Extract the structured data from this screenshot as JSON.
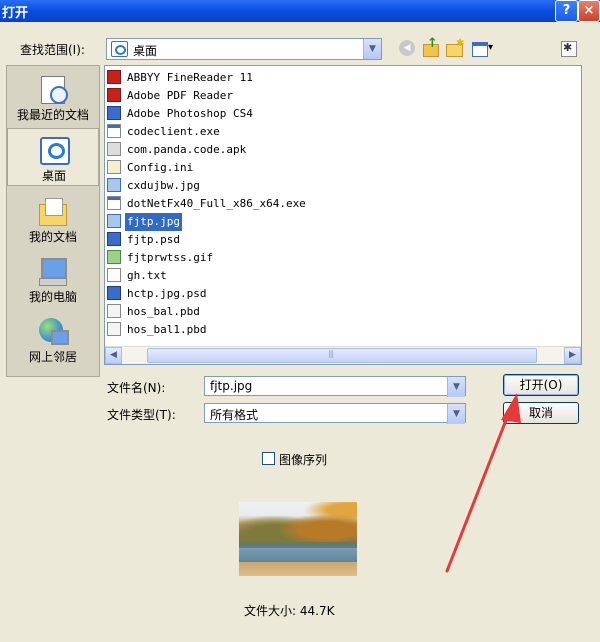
{
  "window": {
    "title": "打开",
    "help_glyph": "?",
    "close_glyph": "×"
  },
  "look_in": {
    "label": "查找范围(I):",
    "value": "桌面"
  },
  "places": [
    {
      "label": "我最近的文档",
      "icon": "recent-documents-icon"
    },
    {
      "label": "桌面",
      "icon": "desktop-icon",
      "selected": true
    },
    {
      "label": "我的文档",
      "icon": "my-documents-icon"
    },
    {
      "label": "我的电脑",
      "icon": "my-computer-icon"
    },
    {
      "label": "网上邻居",
      "icon": "network-places-icon"
    }
  ],
  "files": [
    {
      "name": "ABBYY FineReader 11",
      "icon": "abbyy-icon"
    },
    {
      "name": "Adobe PDF Reader",
      "icon": "pdf-icon"
    },
    {
      "name": "Adobe Photoshop CS4",
      "icon": "photoshop-icon"
    },
    {
      "name": "codeclient.exe",
      "icon": "exe-icon"
    },
    {
      "name": "com.panda.code.apk",
      "icon": "apk-icon"
    },
    {
      "name": "Config.ini",
      "icon": "ini-icon"
    },
    {
      "name": "cxdujbw.jpg",
      "icon": "jpg-icon"
    },
    {
      "name": "dotNetFx40_Full_x86_x64.exe",
      "icon": "exe-icon"
    },
    {
      "name": "fjtp.jpg",
      "icon": "jpg-icon",
      "selected": true
    },
    {
      "name": "fjtp.psd",
      "icon": "psd-icon"
    },
    {
      "name": "fjtprwtss.gif",
      "icon": "gif-icon"
    },
    {
      "name": "gh.txt",
      "icon": "txt-icon"
    },
    {
      "name": "hctp.jpg.psd",
      "icon": "psd-icon"
    },
    {
      "name": "hos_bal.pbd",
      "icon": "pbd-icon"
    },
    {
      "name": "hos_bal1.pbd",
      "icon": "pbd-icon"
    }
  ],
  "filename": {
    "label": "文件名(N):",
    "value": "fjtp.jpg"
  },
  "filetype": {
    "label": "文件类型(T):",
    "value": "所有格式"
  },
  "buttons": {
    "open": "打开(O)",
    "cancel": "取消"
  },
  "image_sequence": {
    "label": "图像序列",
    "checked": false
  },
  "file_size": "文件大小: 44.7K",
  "colors": {
    "titlebar": "#0a4ee0",
    "selection": "#316ac5",
    "annotation_arrow": "#e53a3a"
  }
}
